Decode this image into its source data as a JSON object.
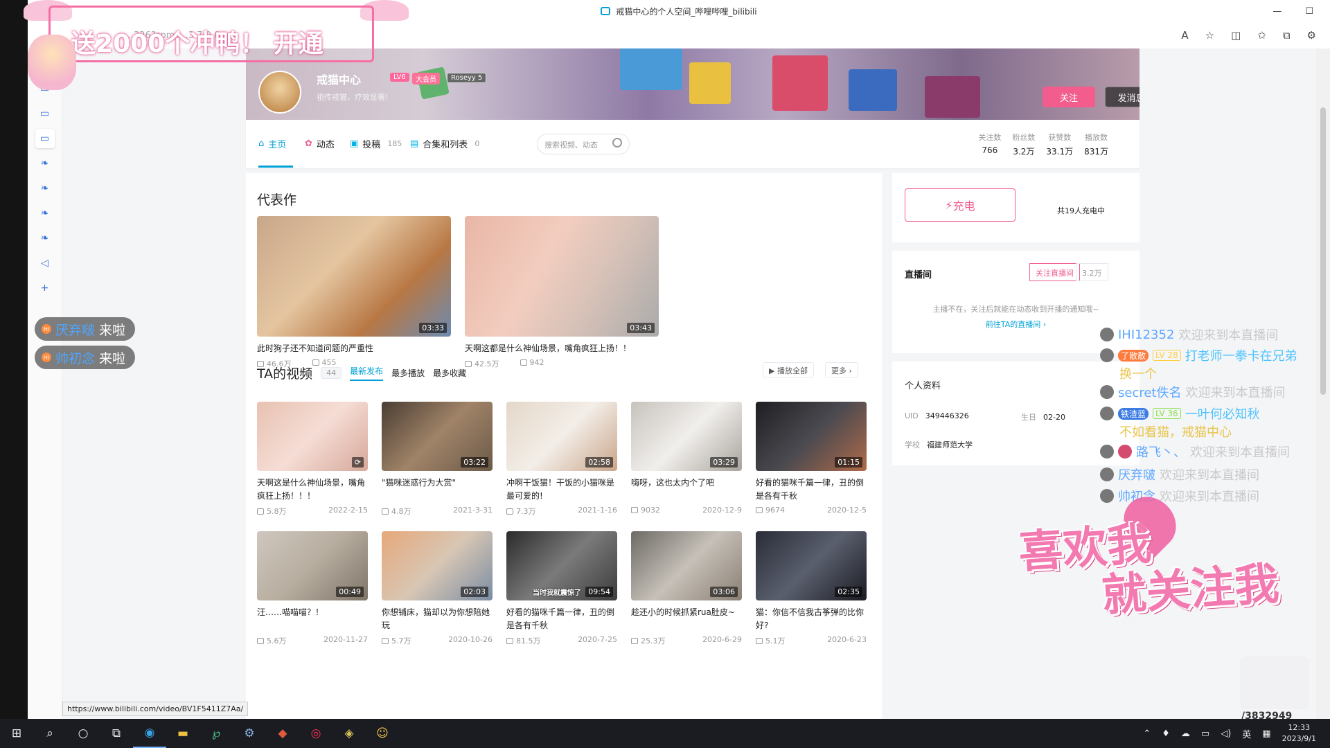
{
  "window": {
    "title": "戒猫中心的个人空间_哔哩哔哩_bilibili",
    "controls": [
      "—",
      "☐"
    ]
  },
  "browser": {
    "url": "…326?spm_…3.7.0.0"
  },
  "sidenav": {
    "icons": [
      "paw-icon",
      "tv-icon",
      "tv-icon",
      "tv-icon",
      "feather-icon",
      "feather-icon",
      "feather-icon",
      "feather-icon",
      "speaker-icon",
      "plus-icon"
    ]
  },
  "profile": {
    "name": "戒猫中心",
    "level": "LV6",
    "vip": "大会员",
    "tag": "Roseyy",
    "tag_level": "5",
    "sign": "祖传戒猫，疗效显著!",
    "follow_label": "关注",
    "message_label": "发消息"
  },
  "nav": {
    "tabs": [
      {
        "label": "主页",
        "count": ""
      },
      {
        "label": "动态",
        "count": ""
      },
      {
        "label": "投稿",
        "count": "185"
      },
      {
        "label": "合集和列表",
        "count": "0"
      }
    ],
    "search_placeholder": "搜索视频、动态",
    "stats": [
      {
        "label": "关注数",
        "value": "766"
      },
      {
        "label": "粉丝数",
        "value": "3.2万"
      },
      {
        "label": "获赞数",
        "value": "33.1万"
      },
      {
        "label": "播放数",
        "value": "831万"
      }
    ]
  },
  "masterpiece": {
    "title": "代表作",
    "items": [
      {
        "title": "此时狗子还不知道问题的严重性",
        "duration": "03:33",
        "plays": "46.6万",
        "comments": "455"
      },
      {
        "title": "天啊这都是什么神仙场景，嘴角疯狂上扬！！",
        "duration": "03:43",
        "plays": "42.5万",
        "comments": "942"
      }
    ]
  },
  "videos": {
    "title": "TA的视频",
    "count": "44",
    "sorts": [
      "最新发布",
      "最多播放",
      "最多收藏"
    ],
    "play_all": "播放全部",
    "more": "更多",
    "items": [
      {
        "title": "天啊这是什么神仙场景，嘴角疯狂上扬！！！",
        "duration": "",
        "plays": "5.8万",
        "date": "2022-2-15"
      },
      {
        "title": "\"猫咪迷惑行为大赏\"",
        "duration": "03:22",
        "plays": "4.8万",
        "date": "2021-3-31"
      },
      {
        "title": "冲啊干饭猫！干饭的小猫咪是最可爱的!",
        "duration": "02:58",
        "plays": "7.3万",
        "date": "2021-1-16"
      },
      {
        "title": "嗨呀，这也太内个了吧",
        "duration": "03:29",
        "plays": "9032",
        "date": "2020-12-9"
      },
      {
        "title": "好看的猫咪千篇一律，丑的倒是各有千秋",
        "duration": "01:15",
        "plays": "9674",
        "date": "2020-12-5"
      },
      {
        "title": "汪……喵喵喵？！",
        "duration": "00:49",
        "plays": "5.6万",
        "date": "2020-11-27"
      },
      {
        "title": "你想铺床，猫却以为你想陪她玩",
        "duration": "02:03",
        "plays": "5.7万",
        "date": "2020-10-26"
      },
      {
        "title": "好看的猫咪千篇一律，丑的倒是各有千秋",
        "duration": "09:54",
        "plays": "81.5万",
        "date": "2020-7-25"
      },
      {
        "title": "趁还小的时候抓紧rua肚皮~",
        "duration": "03:06",
        "plays": "25.3万",
        "date": "2020-6-29"
      },
      {
        "title": "猫：你信不信我古筝弹的比你好?",
        "duration": "02:35",
        "plays": "5.1万",
        "date": "2020-6-23"
      }
    ],
    "thumb_caption": "当时我就震惊了"
  },
  "charge": {
    "label": "充电",
    "count_text": "共19人充电中"
  },
  "live": {
    "title": "直播间",
    "follow_label": "关注直播间",
    "count": "3.2万",
    "note": "主播不在，关注后就能在动态收到开播的通知哦~",
    "link": "前往TA的直播间"
  },
  "profile_info": {
    "title": "个人资料",
    "uid_label": "UID",
    "uid": "349446326",
    "birthday_label": "生日",
    "birthday": "02-20",
    "school_label": "学校",
    "school": "福建师范大学"
  },
  "status_url": "https://www.bilibili.com/video/BV1F5411Z7Aa/",
  "overlay": {
    "gift_text": "送2000个冲鸭！ 开通",
    "joins": [
      {
        "name": "厌弃啵",
        "text": "来啦"
      },
      {
        "name": "帅初念",
        "text": "来啦"
      }
    ],
    "chat": [
      {
        "name": "IHI12352",
        "text": "欢迎来到本直播间",
        "medal": "",
        "level": ""
      },
      {
        "name": "打老师一拳卡在兄弟",
        "text": "换一个",
        "medal": "了散散",
        "level": "LV 28"
      },
      {
        "name": "secret佚名",
        "text": "欢迎来到本直播间",
        "medal": "",
        "level": ""
      },
      {
        "name": "一叶何必知秋",
        "text": "不如看猫，戒猫中心",
        "medal": "铁渣蓝",
        "level": "LV 36"
      },
      {
        "name": "路飞丶、",
        "text": "欢迎来到本直播间",
        "medal": "",
        "level": ""
      },
      {
        "name": "厌弃啵",
        "text": "欢迎来到本直播间",
        "medal": "",
        "level": ""
      },
      {
        "name": "帅初念",
        "text": "欢迎来到本直播间",
        "medal": "",
        "level": ""
      }
    ],
    "big_line1": "喜欢我",
    "big_line2": "就关注我",
    "room_id": "/3832949"
  },
  "taskbar": {
    "time": "12:33",
    "date": "2023/9/1",
    "ime": "英"
  }
}
